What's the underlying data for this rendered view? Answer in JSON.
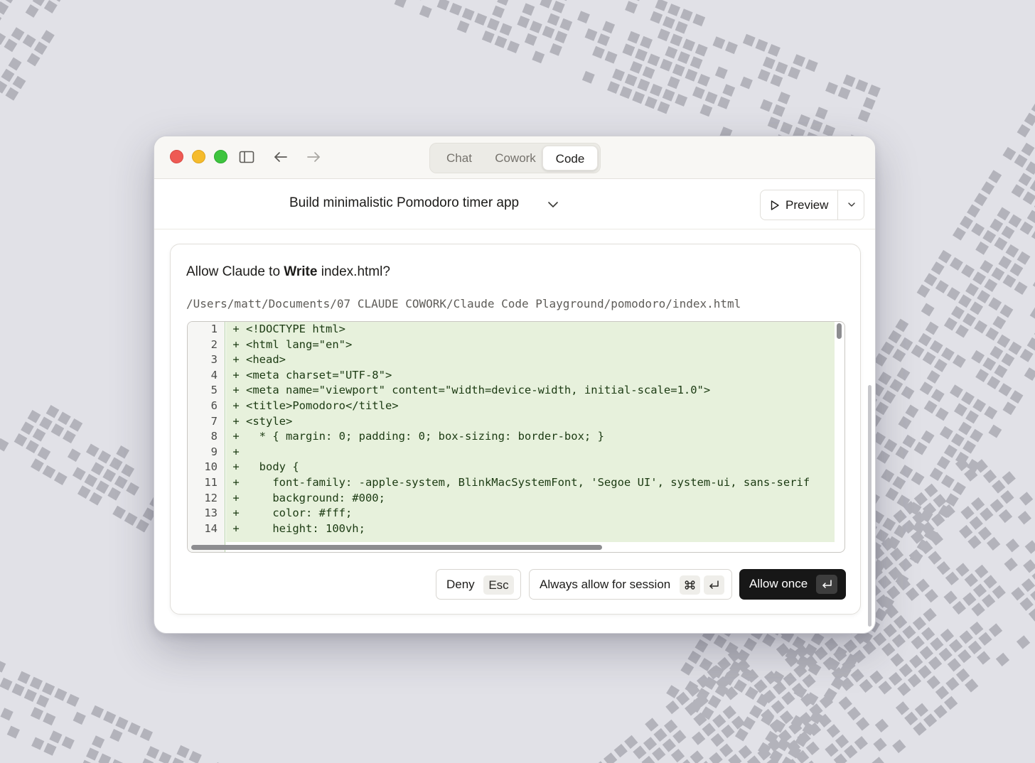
{
  "window": {
    "traffic_lights": [
      "close",
      "minimize",
      "zoom"
    ],
    "nav": {
      "sidebar_icon": "sidebar-icon",
      "back_icon": "arrow-left-icon",
      "forward_icon": "arrow-right-icon"
    },
    "mode_tabs": [
      {
        "label": "Chat",
        "selected": false
      },
      {
        "label": "Cowork",
        "selected": false
      },
      {
        "label": "Code",
        "selected": true
      }
    ]
  },
  "header": {
    "title": "Build minimalistic Pomodoro timer app",
    "preview_label": "Preview"
  },
  "dialog": {
    "prompt_prefix": "Allow Claude to ",
    "prompt_action": "Write",
    "prompt_suffix": " index.html?",
    "file_path": "/Users/matt/Documents/07 CLAUDE COWORK/Claude Code Playground/pomodoro/index.html",
    "code_lines": [
      {
        "n": "1",
        "text": "<!DOCTYPE html>"
      },
      {
        "n": "2",
        "text": "<html lang=\"en\">"
      },
      {
        "n": "3",
        "text": "<head>"
      },
      {
        "n": "4",
        "text": "<meta charset=\"UTF-8\">"
      },
      {
        "n": "5",
        "text": "<meta name=\"viewport\" content=\"width=device-width, initial-scale=1.0\">"
      },
      {
        "n": "6",
        "text": "<title>Pomodoro</title>"
      },
      {
        "n": "7",
        "text": "<style>"
      },
      {
        "n": "8",
        "text": "  * { margin: 0; padding: 0; box-sizing: border-box; }"
      },
      {
        "n": "9",
        "text": ""
      },
      {
        "n": "10",
        "text": "  body {"
      },
      {
        "n": "11",
        "text": "    font-family: -apple-system, BlinkMacSystemFont, 'Segoe UI', system-ui, sans-serif"
      },
      {
        "n": "12",
        "text": "    background: #000;"
      },
      {
        "n": "13",
        "text": "    color: #fff;"
      },
      {
        "n": "14",
        "text": "    height: 100vh;"
      }
    ],
    "buttons": {
      "deny": {
        "label": "Deny",
        "shortcut": "Esc"
      },
      "always": {
        "label": "Always allow for session",
        "shortcut_icons": [
          "command-icon",
          "return-icon"
        ]
      },
      "allow": {
        "label": "Allow once",
        "shortcut_icon": "return-icon"
      }
    }
  },
  "colors": {
    "diff_added_bg": "#e7f1dc",
    "primary_button": "#171717",
    "close": "#ee5a54",
    "minimize": "#f5bb2c",
    "zoom": "#3ec43e"
  }
}
